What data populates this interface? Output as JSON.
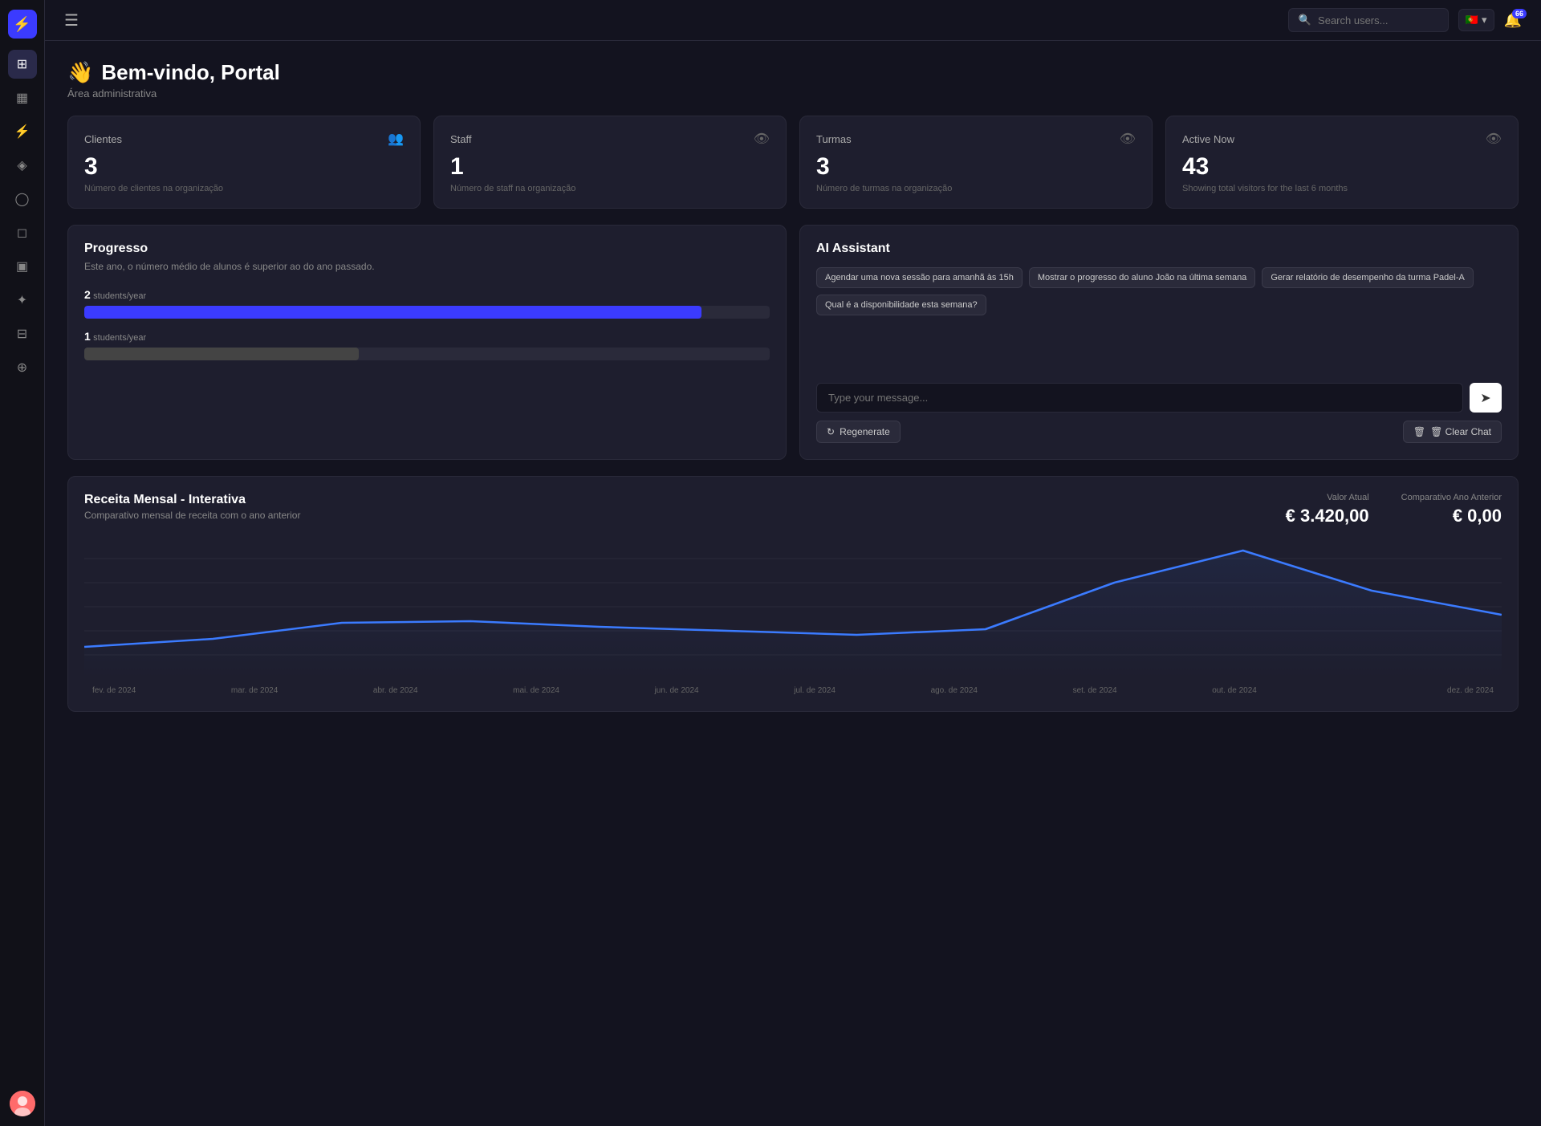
{
  "app": {
    "logo": "⚡",
    "menu_toggle": "☰"
  },
  "topbar": {
    "search_placeholder": "Search users...",
    "flag": "🇵🇹",
    "flag_chevron": "▾",
    "notification_count": "66"
  },
  "page": {
    "emoji": "👋",
    "title": "Bem-vindo, Portal",
    "subtitle": "Área administrativa"
  },
  "stats": [
    {
      "title": "Clientes",
      "value": "3",
      "desc": "Número de clientes na organização",
      "icon": "👥"
    },
    {
      "title": "Staff",
      "value": "1",
      "desc": "Número de staff na organização",
      "icon": "👁"
    },
    {
      "title": "Turmas",
      "value": "3",
      "desc": "Número de turmas na organização",
      "icon": "👁"
    },
    {
      "title": "Active Now",
      "value": "43",
      "desc": "Showing total visitors for the last 6 months",
      "icon": "👁"
    }
  ],
  "progress": {
    "title": "Progresso",
    "desc": "Este ano, o número médio de alunos é superior ao do ano passado.",
    "bars": [
      {
        "value": 2,
        "unit": "students/year",
        "fill_pct": 90
      },
      {
        "value": 1,
        "unit": "students/year",
        "fill_pct": 40
      }
    ]
  },
  "ai_assistant": {
    "title": "AI Assistant",
    "suggestions": [
      "Agendar uma nova sessão para amanhã às 15h",
      "Mostrar o progresso do aluno João na última semana",
      "Gerar relatório de desempenho da turma Padel-A",
      "Qual é a disponibilidade esta semana?"
    ],
    "input_placeholder": "Type your message...",
    "send_icon": "➤",
    "regenerate_label": "↻ Regenerate",
    "clear_label": "🗑 Clear Chat"
  },
  "revenue": {
    "title": "Receita Mensal - Interativa",
    "desc": "Comparativo mensal de receita com o ano anterior",
    "valor_atual_label": "Valor Atual",
    "valor_atual": "€ 3.420,00",
    "comparativo_label": "Comparativo Ano Anterior",
    "comparativo": "€ 0,00",
    "x_labels": [
      "fev. de 2024",
      "mar. de 2024",
      "abr. de 2024",
      "mai. de 2024",
      "jun. de 2024",
      "jul. de 2024",
      "ago. de 2024",
      "set. de 2024",
      "out. de 2024",
      "",
      "dez. de 2024"
    ]
  },
  "sidebar_icons": [
    {
      "name": "grid-icon",
      "glyph": "⊞",
      "active": true
    },
    {
      "name": "calendar-icon",
      "glyph": "📅",
      "active": false
    },
    {
      "name": "lightning-icon",
      "glyph": "⚡",
      "active": false
    },
    {
      "name": "tag-icon",
      "glyph": "🏷",
      "active": false
    },
    {
      "name": "chat-icon",
      "glyph": "💬",
      "active": false
    },
    {
      "name": "bag-icon",
      "glyph": "🛍",
      "active": false
    },
    {
      "name": "screen-icon",
      "glyph": "🖥",
      "active": false
    },
    {
      "name": "puzzle-icon",
      "glyph": "🧩",
      "active": false
    },
    {
      "name": "book-icon",
      "glyph": "📖",
      "active": false
    },
    {
      "name": "shield-icon",
      "glyph": "🛡",
      "active": false
    }
  ]
}
